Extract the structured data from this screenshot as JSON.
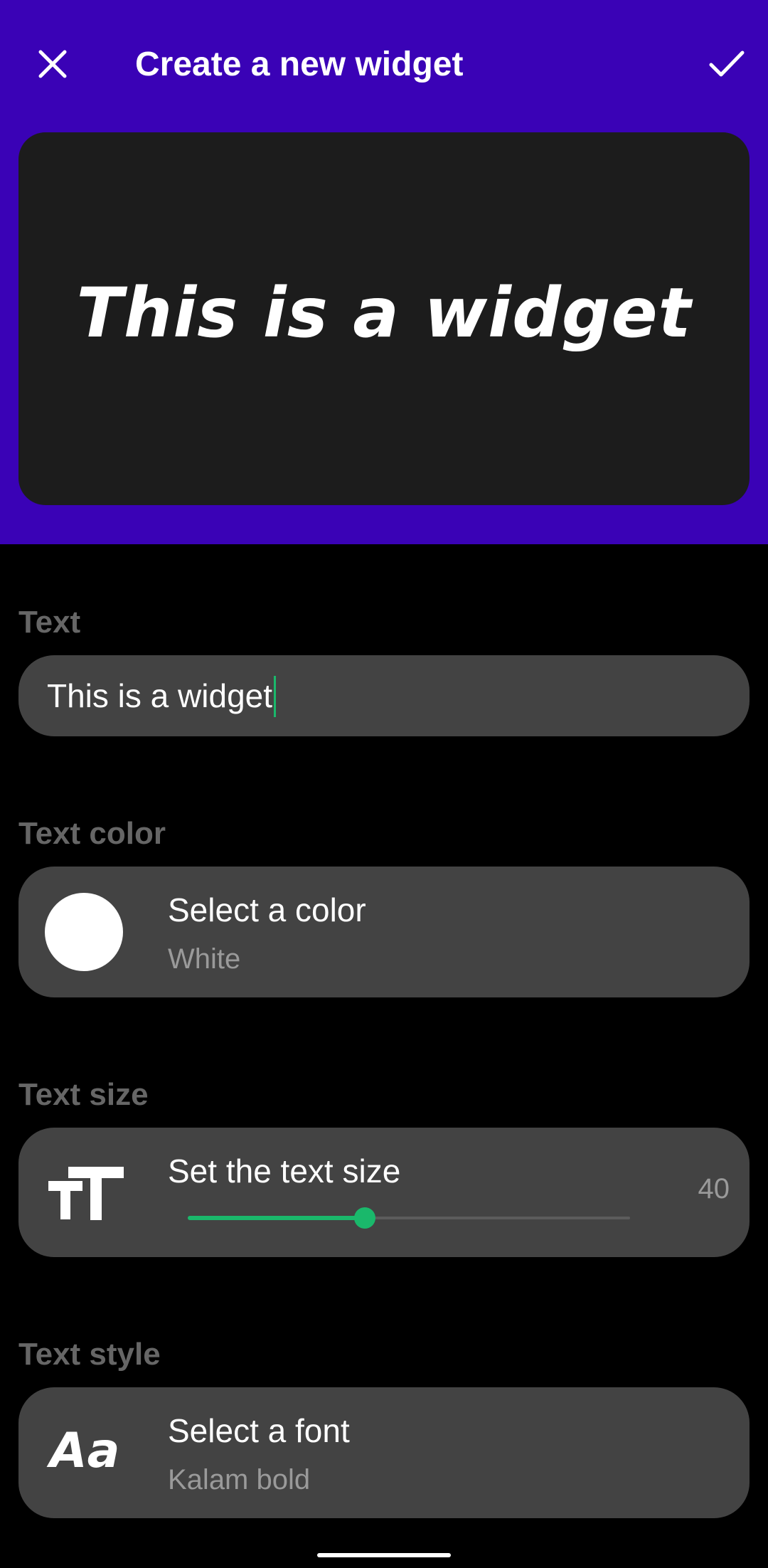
{
  "header": {
    "title": "Create a new widget",
    "close_icon": "close-icon",
    "confirm_icon": "check-icon",
    "background_color": "#3a02b6"
  },
  "preview": {
    "text": "This is a widget"
  },
  "text_section": {
    "label": "Text",
    "value": "This is a widget"
  },
  "color_section": {
    "label": "Text color",
    "title": "Select a color",
    "value": "White",
    "swatch_color": "#ffffff"
  },
  "size_section": {
    "label": "Text size",
    "title": "Set the text size",
    "value": "40",
    "icon": "text-size-icon",
    "slider_fraction": 0.4,
    "accent_color": "#1ab86b"
  },
  "style_section": {
    "label": "Text style",
    "title": "Select a font",
    "value": "Kalam bold",
    "icon_text": "Aa"
  }
}
